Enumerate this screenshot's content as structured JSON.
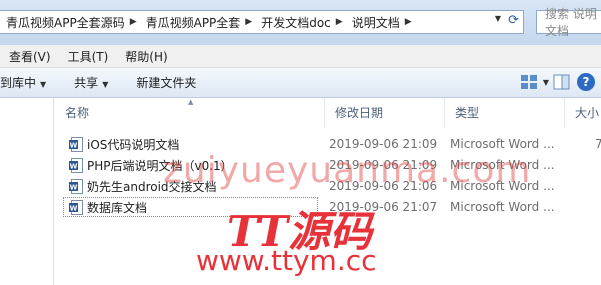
{
  "address": {
    "crumbs": [
      "青瓜视频APP全套源码",
      "青瓜视频APP全套",
      "开发文档doc",
      "说明文档"
    ],
    "search_placeholder": "搜索 说明文档"
  },
  "menu": [
    "查看(V)",
    "工具(T)",
    "帮助(H)"
  ],
  "toolbar": {
    "include_label": "到库中",
    "share_label": "共享",
    "new_folder_label": "新建文件夹"
  },
  "columns": {
    "name": "名称",
    "date": "修改日期",
    "type": "类型",
    "size": "大小"
  },
  "files": [
    {
      "name": "iOS代码说明文档",
      "date": "2019-09-06 21:09",
      "type": "Microsoft Word ...",
      "size": "7"
    },
    {
      "name": "PHP后端说明文档（v0.1）",
      "date": "2019-09-06 21:09",
      "type": "Microsoft Word ...",
      "size": ""
    },
    {
      "name": "奶先生android交接文档",
      "date": "2019-09-06 21:06",
      "type": "Microsoft Word ...",
      "size": ""
    },
    {
      "name": "数据库文档",
      "date": "2019-09-06 21:07",
      "type": "Microsoft Word ...",
      "size": ""
    }
  ],
  "watermark": {
    "line1": "zuiyueyuanma.com",
    "logo": "TT源码",
    "url": "www.ttym.cc"
  },
  "colors": {
    "watermark_red": "#e8323a",
    "word_icon_blue": "#2b5797"
  }
}
